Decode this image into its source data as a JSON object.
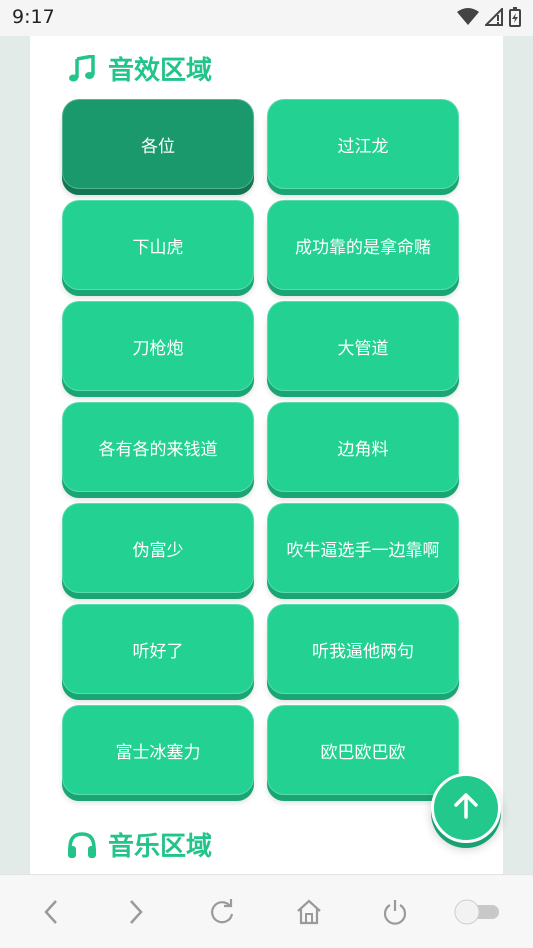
{
  "status_bar": {
    "time": "9:17",
    "icons": [
      "wifi-icon",
      "signal-icon",
      "battery-charging-icon"
    ]
  },
  "sections": {
    "sound_effects": {
      "title": "音效区域",
      "icon": "music-note-icon",
      "buttons": [
        {
          "label": "各位",
          "state": "pressed"
        },
        {
          "label": "过江龙"
        },
        {
          "label": "下山虎"
        },
        {
          "label": "成功靠的是拿命赌"
        },
        {
          "label": "刀枪炮"
        },
        {
          "label": "大管道"
        },
        {
          "label": "各有各的来钱道"
        },
        {
          "label": "边角料"
        },
        {
          "label": "伪富少"
        },
        {
          "label": "吹牛逼选手一边靠啊"
        },
        {
          "label": "听好了"
        },
        {
          "label": "听我逼他两句"
        },
        {
          "label": "富士冰塞力"
        },
        {
          "label": "欧巴欧巴欧"
        }
      ]
    },
    "music": {
      "title": "音乐区域",
      "icon": "headphones-icon"
    }
  },
  "fab": {
    "icon": "arrow-up-icon"
  },
  "nav_bar": {
    "items": [
      "back-icon",
      "forward-icon",
      "reload-icon",
      "home-icon",
      "power-icon",
      "toggle-switch"
    ]
  },
  "colors": {
    "accent": "#22c48a",
    "button": "#23d192",
    "button_pressed": "#1a9a6c",
    "side_bg": "#e3ebe8"
  }
}
